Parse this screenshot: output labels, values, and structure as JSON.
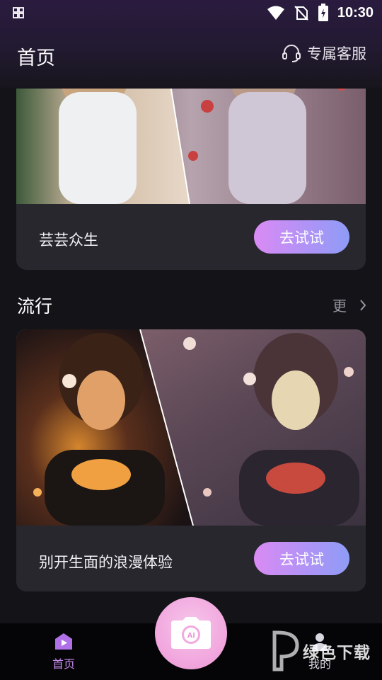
{
  "status_bar": {
    "time": "10:30"
  },
  "header": {
    "title": "首页",
    "service_label": "专属客服"
  },
  "cards": [
    {
      "caption": "芸芸众生",
      "button_label": "去试试"
    },
    {
      "caption": "别开生面的浪漫体验",
      "button_label": "去试试"
    }
  ],
  "section": {
    "title": "流行",
    "more_label": "更"
  },
  "bottom_nav": {
    "home_label": "首页",
    "mine_label": "我的",
    "camera_text": "AI"
  },
  "watermark": {
    "text": "绿色下载"
  },
  "colors": {
    "accent_pink": "#e9a0f2",
    "accent_blue": "#8e9cf6",
    "background": "#141318",
    "card": "#28272d",
    "nav_active": "#c98cf0"
  },
  "icons": [
    "grid-icon",
    "wifi-icon",
    "no-sim-icon",
    "battery-icon",
    "headset-icon",
    "chevron-right-icon",
    "home-icon",
    "camera-icon",
    "person-icon"
  ]
}
